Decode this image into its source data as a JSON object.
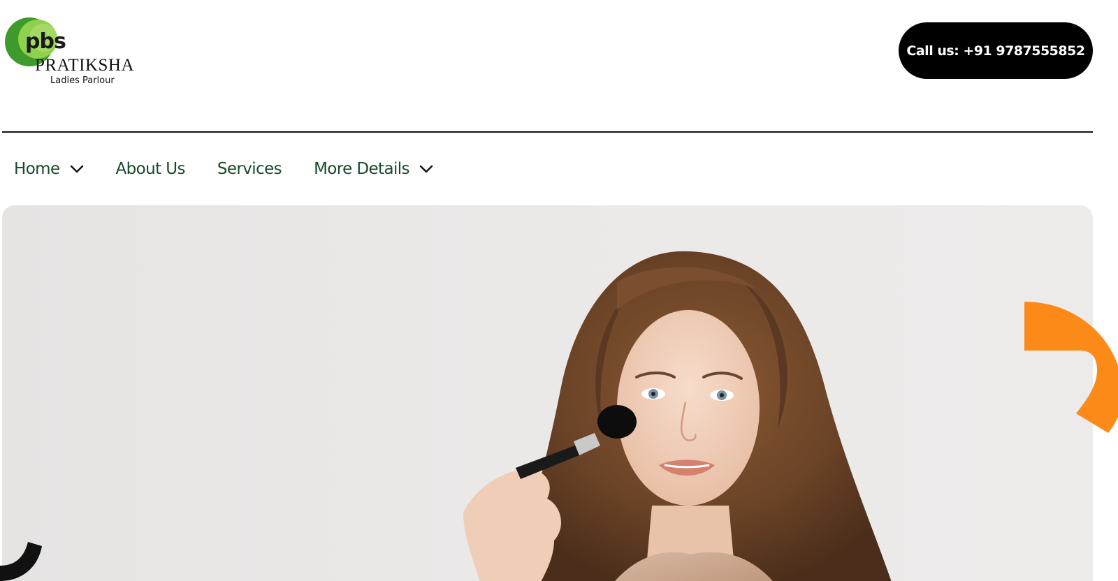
{
  "brand": {
    "initials": "pbs",
    "name": "PRATIKSHA",
    "tagline": "Ladies Parlour",
    "colors": {
      "ring_dark": "#3e9a2a",
      "ring_light": "#8fd14a"
    }
  },
  "header": {
    "call_label": "Call us: +91 9787555852"
  },
  "nav": {
    "items": [
      {
        "label": "Home",
        "has_dropdown": true
      },
      {
        "label": "About Us",
        "has_dropdown": false
      },
      {
        "label": "Services",
        "has_dropdown": false
      },
      {
        "label": "More Details",
        "has_dropdown": true
      }
    ]
  },
  "hero": {
    "image": "woman-applying-makeup-brush",
    "accent_orange": "#fb8a19",
    "accent_black": "#111111"
  },
  "icons": [
    "chevron-down-icon",
    "logo-mark"
  ]
}
